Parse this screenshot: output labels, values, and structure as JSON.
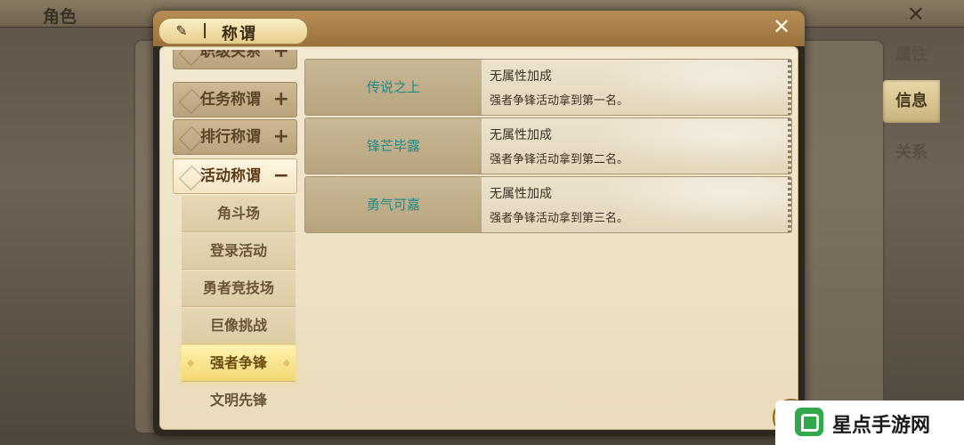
{
  "background": {
    "title": "角色",
    "close_icon": "close-icon",
    "tabs": [
      {
        "label": "属性",
        "active": false
      },
      {
        "label": "信息",
        "active": true
      },
      {
        "label": "关系",
        "active": false
      }
    ]
  },
  "dialog": {
    "title": "称谓",
    "separator": "|",
    "title_icon": "scroll-icon",
    "close_label": "✕"
  },
  "nav": {
    "categories": [
      {
        "label": "职级关系",
        "sign": "+"
      },
      {
        "label": "任务称谓",
        "sign": "+"
      },
      {
        "label": "排行称谓",
        "sign": "+"
      },
      {
        "label": "活动称谓",
        "sign": "−"
      }
    ],
    "subitems": [
      {
        "label": "角斗场",
        "selected": false
      },
      {
        "label": "登录活动",
        "selected": false
      },
      {
        "label": "勇者竞技场",
        "selected": false
      },
      {
        "label": "巨像挑战",
        "selected": false
      },
      {
        "label": "强者争锋",
        "selected": true
      },
      {
        "label": "文明先锋",
        "selected": false
      }
    ]
  },
  "titles": [
    {
      "name": "传说之上",
      "attribute": "无属性加成",
      "description": "强者争锋活动拿到第一名。"
    },
    {
      "name": "锋芒毕露",
      "attribute": "无属性加成",
      "description": "强者争锋活动拿到第二名。"
    },
    {
      "name": "勇气可嘉",
      "attribute": "无属性加成",
      "description": "强者争锋活动拿到第三名。"
    }
  ],
  "watermark": {
    "text": "星点手游网"
  },
  "colors": {
    "title_name": "#1f8a86",
    "header": "#b78e55",
    "selected_item": "#f2d772"
  }
}
